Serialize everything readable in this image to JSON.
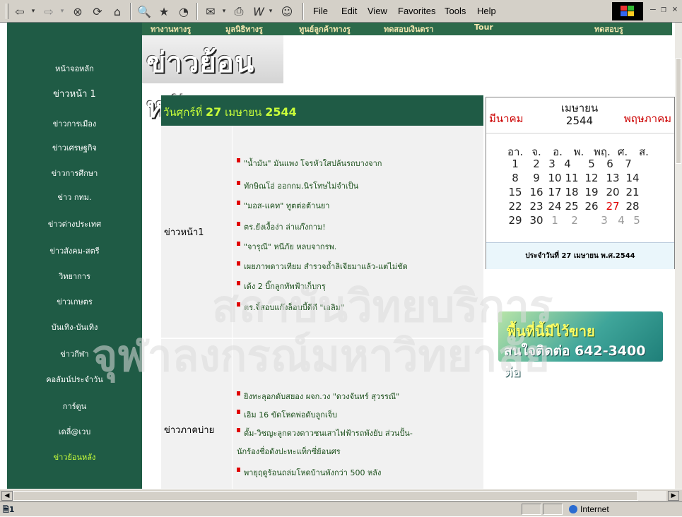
{
  "browser": {
    "menu": [
      "File",
      "Edit",
      "View",
      "Favorites",
      "Tools",
      "Help"
    ],
    "status_zone": "Internet",
    "status_icon_text": "1"
  },
  "top_banner": [
    "ทางานทางรู",
    "มูลนิธิทางรู",
    "ทูนย์ลูกค้าทางรู",
    "ทดสอบเงินตรา",
    "Tour",
    "ทดสอบรู"
  ],
  "title_banner": "ข่าวย้อนหลัง",
  "watermark": [
    "สถาบันวิทยบริการ",
    "จุฬาลงกรณ์มหาวิทยาลัย"
  ],
  "sidebar": {
    "items": [
      {
        "label": "หน้าจอหลัก",
        "active": false
      },
      {
        "label": "ข่าวหน้า 1",
        "active": false
      },
      {
        "label": "ข่าวการเมือง",
        "active": false
      },
      {
        "label": "ข่าวเศรษฐกิจ",
        "active": false
      },
      {
        "label": "ข่าวการศึกษา",
        "active": false
      },
      {
        "label": "ข่าว กทม.",
        "active": false
      },
      {
        "label": "ข่าวต่างประเทศ",
        "active": false
      },
      {
        "label": "ข่าวสังคม-สตรี",
        "active": false
      },
      {
        "label": "วิทยาการ",
        "active": false
      },
      {
        "label": "ข่าวเกษตร",
        "active": false
      },
      {
        "label": "บันเทิง-บันเทิง",
        "active": false
      },
      {
        "label": "ข่าวกีฬา",
        "active": false
      },
      {
        "label": "คอลัมน์ประจำวัน",
        "active": false
      },
      {
        "label": "การ์ตูน",
        "active": false
      },
      {
        "label": "เดลี่@เวบ",
        "active": false
      },
      {
        "label": "ข่าวย้อนหลัง",
        "active": true
      }
    ]
  },
  "content": {
    "date_prefix": "วันศุกร์ที่",
    "date_day": "27",
    "date_month": "เมษายน",
    "date_year": "2544",
    "sections": [
      {
        "label": "ข่าวหน้า1",
        "items": [
          "\"น้ำมัน\" มันแพง โจรหัวใสปล้นรถบางจาก",
          "ทักษิณโอ่ ออกกม.นิรโทษไม่จำเป็น",
          "\"มอส-แคท\" ทูตต่อต้านยา",
          "ตร.ยังเงื้อง่า ล่าแก๊งกาม!",
          "\"จารุณี\" หนีภัย หลบจากรพ.",
          "เผยภาพดาวเทียม สำรวจถ้ำลิเจียมาแล้ว-แต่ไม่ชัด",
          "เด้ง 2 บิ๊กลูกทัพฟ้าเก็บกรุ",
          "ตร.จี้สอบแก๊งล็อบบี้ดีดี \"เอลิม\""
        ]
      },
      {
        "label": "ข่าวภาคบ่าย",
        "items": [
          "ยิงทะลุอกดับสยอง ผจก.วง \"ดวงจันทร์ สุวรรณี\"",
          "เอิม 16 ขัดโหดพ่อดับลูกเจ็บ",
          "ตั้ม-วิชญะลูกดวงดาวชนเสาไฟฟ้ารถพังยับ ส่วนปั้น-",
          "นักร้องชื่อดังปะทะแท็กซี่ย้อนศร",
          "พายุฤดูร้อนถล่มโหดบ้านพังกว่า 500 หลัง"
        ]
      }
    ]
  },
  "calendar": {
    "prev_month": "มีนาคม",
    "current_month": "เมษายน",
    "current_year": "2544",
    "next_month": "พฤษภาคม",
    "weekdays": [
      "อา.",
      "จ.",
      "อ.",
      "พ.",
      "พฤ.",
      "ศ.",
      "ส."
    ],
    "weeks": [
      [
        "1",
        "2",
        "3",
        "4",
        "5",
        "6",
        "7"
      ],
      [
        "8",
        "9",
        "10",
        "11",
        "12",
        "13",
        "14"
      ],
      [
        "15",
        "16",
        "17",
        "18",
        "19",
        "20",
        "21"
      ],
      [
        "22",
        "23",
        "24",
        "25",
        "26",
        "27",
        "28"
      ],
      [
        "29",
        "30",
        "1",
        "2",
        "3",
        "4",
        "5"
      ]
    ],
    "today": "27",
    "trailing_next_month_days": [
      "1",
      "2",
      "3",
      "4",
      "5"
    ],
    "footer": "ประจำวันที่ 27 เมษายน พ.ศ.2544"
  },
  "ad": {
    "line1": "พื้นที่นี้มีไว้ขาย",
    "line2": "สนใจติดต่อ 642-3400 ต่อ"
  }
}
